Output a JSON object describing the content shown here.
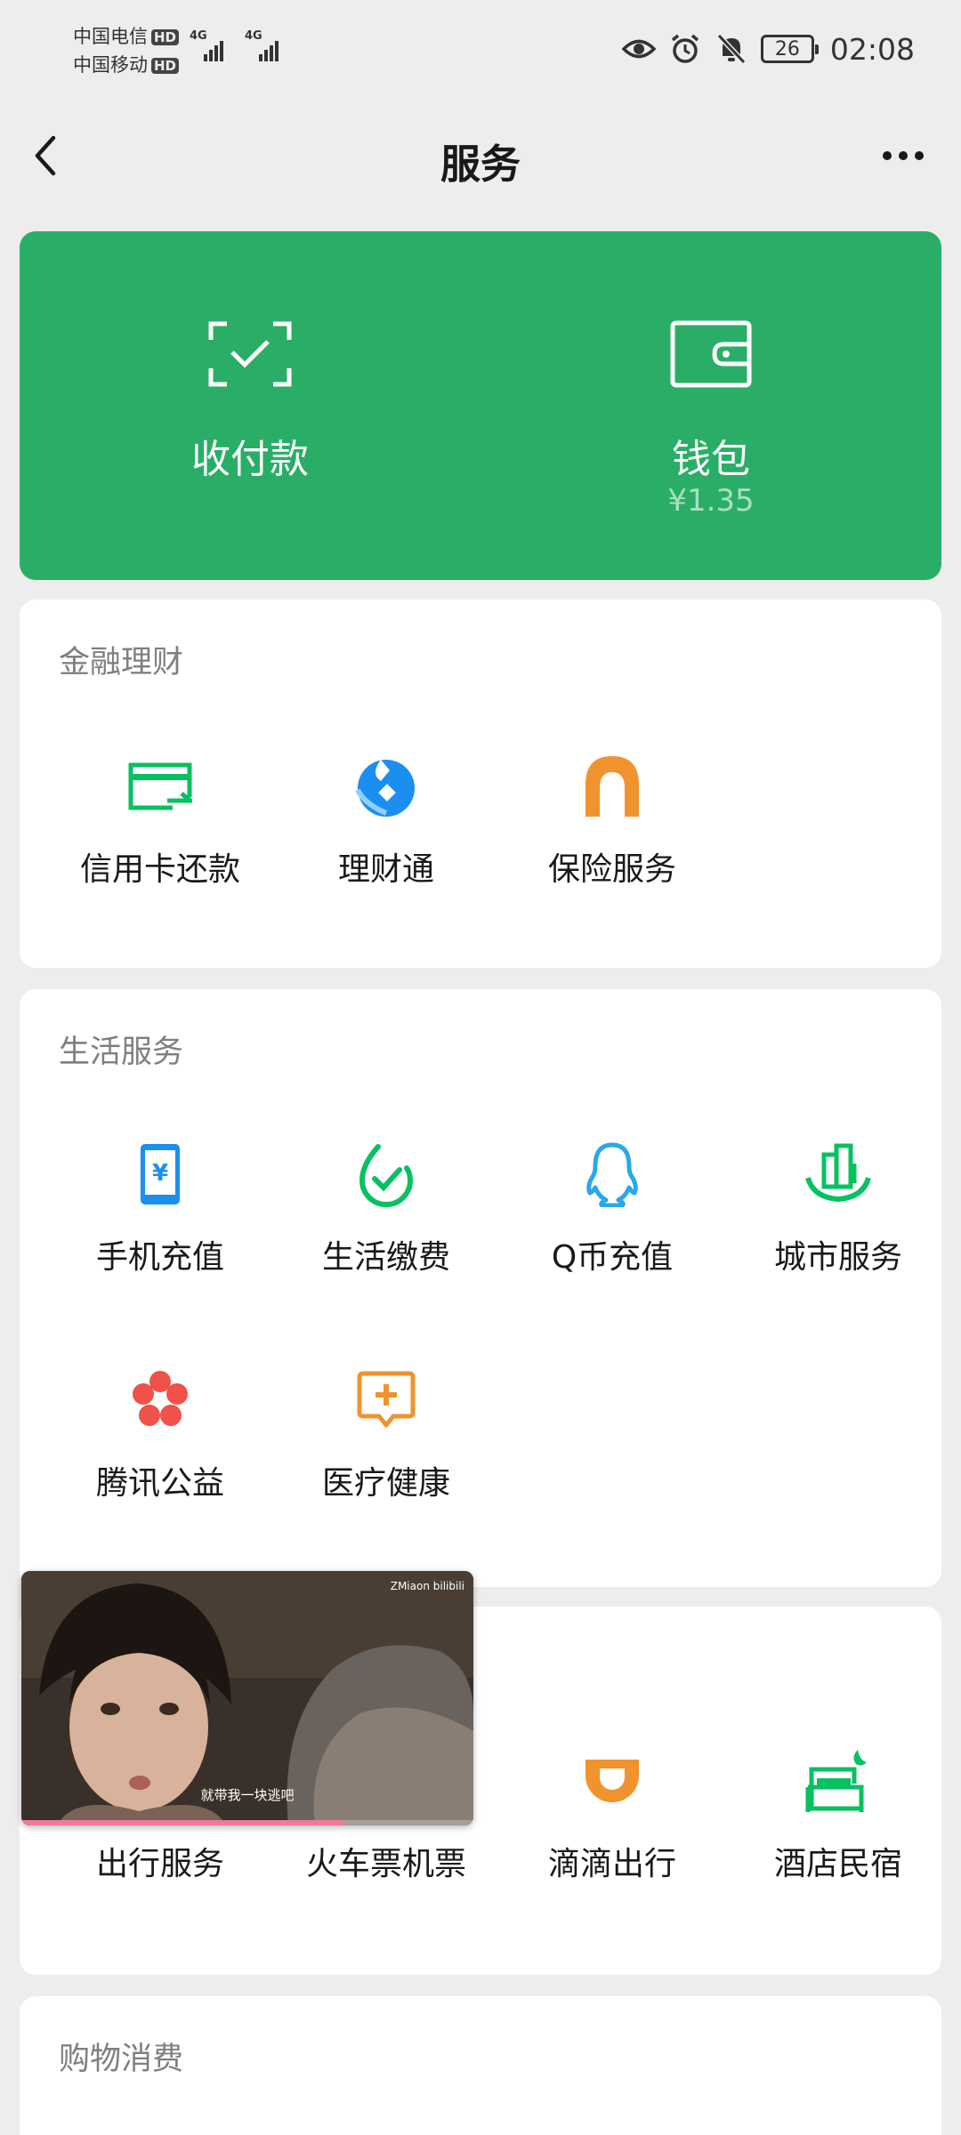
{
  "status_bar": {
    "carrier1": "中国电信",
    "carrier2": "中国移动",
    "hd": "HD",
    "net": "4G",
    "battery": "26",
    "time": "02:08"
  },
  "nav": {
    "title": "服务"
  },
  "wallet_card": {
    "pay_label": "收付款",
    "wallet_label": "钱包",
    "balance": "¥1.35",
    "color": "#2aae67"
  },
  "sections": {
    "finance": {
      "title": "金融理财",
      "items": [
        "信用卡还款",
        "理财通",
        "保险服务"
      ]
    },
    "life": {
      "title": "生活服务",
      "items": [
        "手机充值",
        "生活缴费",
        "Q币充值",
        "城市服务",
        "腾讯公益",
        "医疗健康"
      ]
    },
    "travel": {
      "items": [
        "出行服务",
        "火车票机票",
        "滴滴出行",
        "酒店民宿"
      ]
    },
    "shopping": {
      "title": "购物消费"
    }
  },
  "video": {
    "watermark": "ZMiaon bilibili",
    "subtitle": "就带我一块逃吧",
    "progress": 0.71
  }
}
